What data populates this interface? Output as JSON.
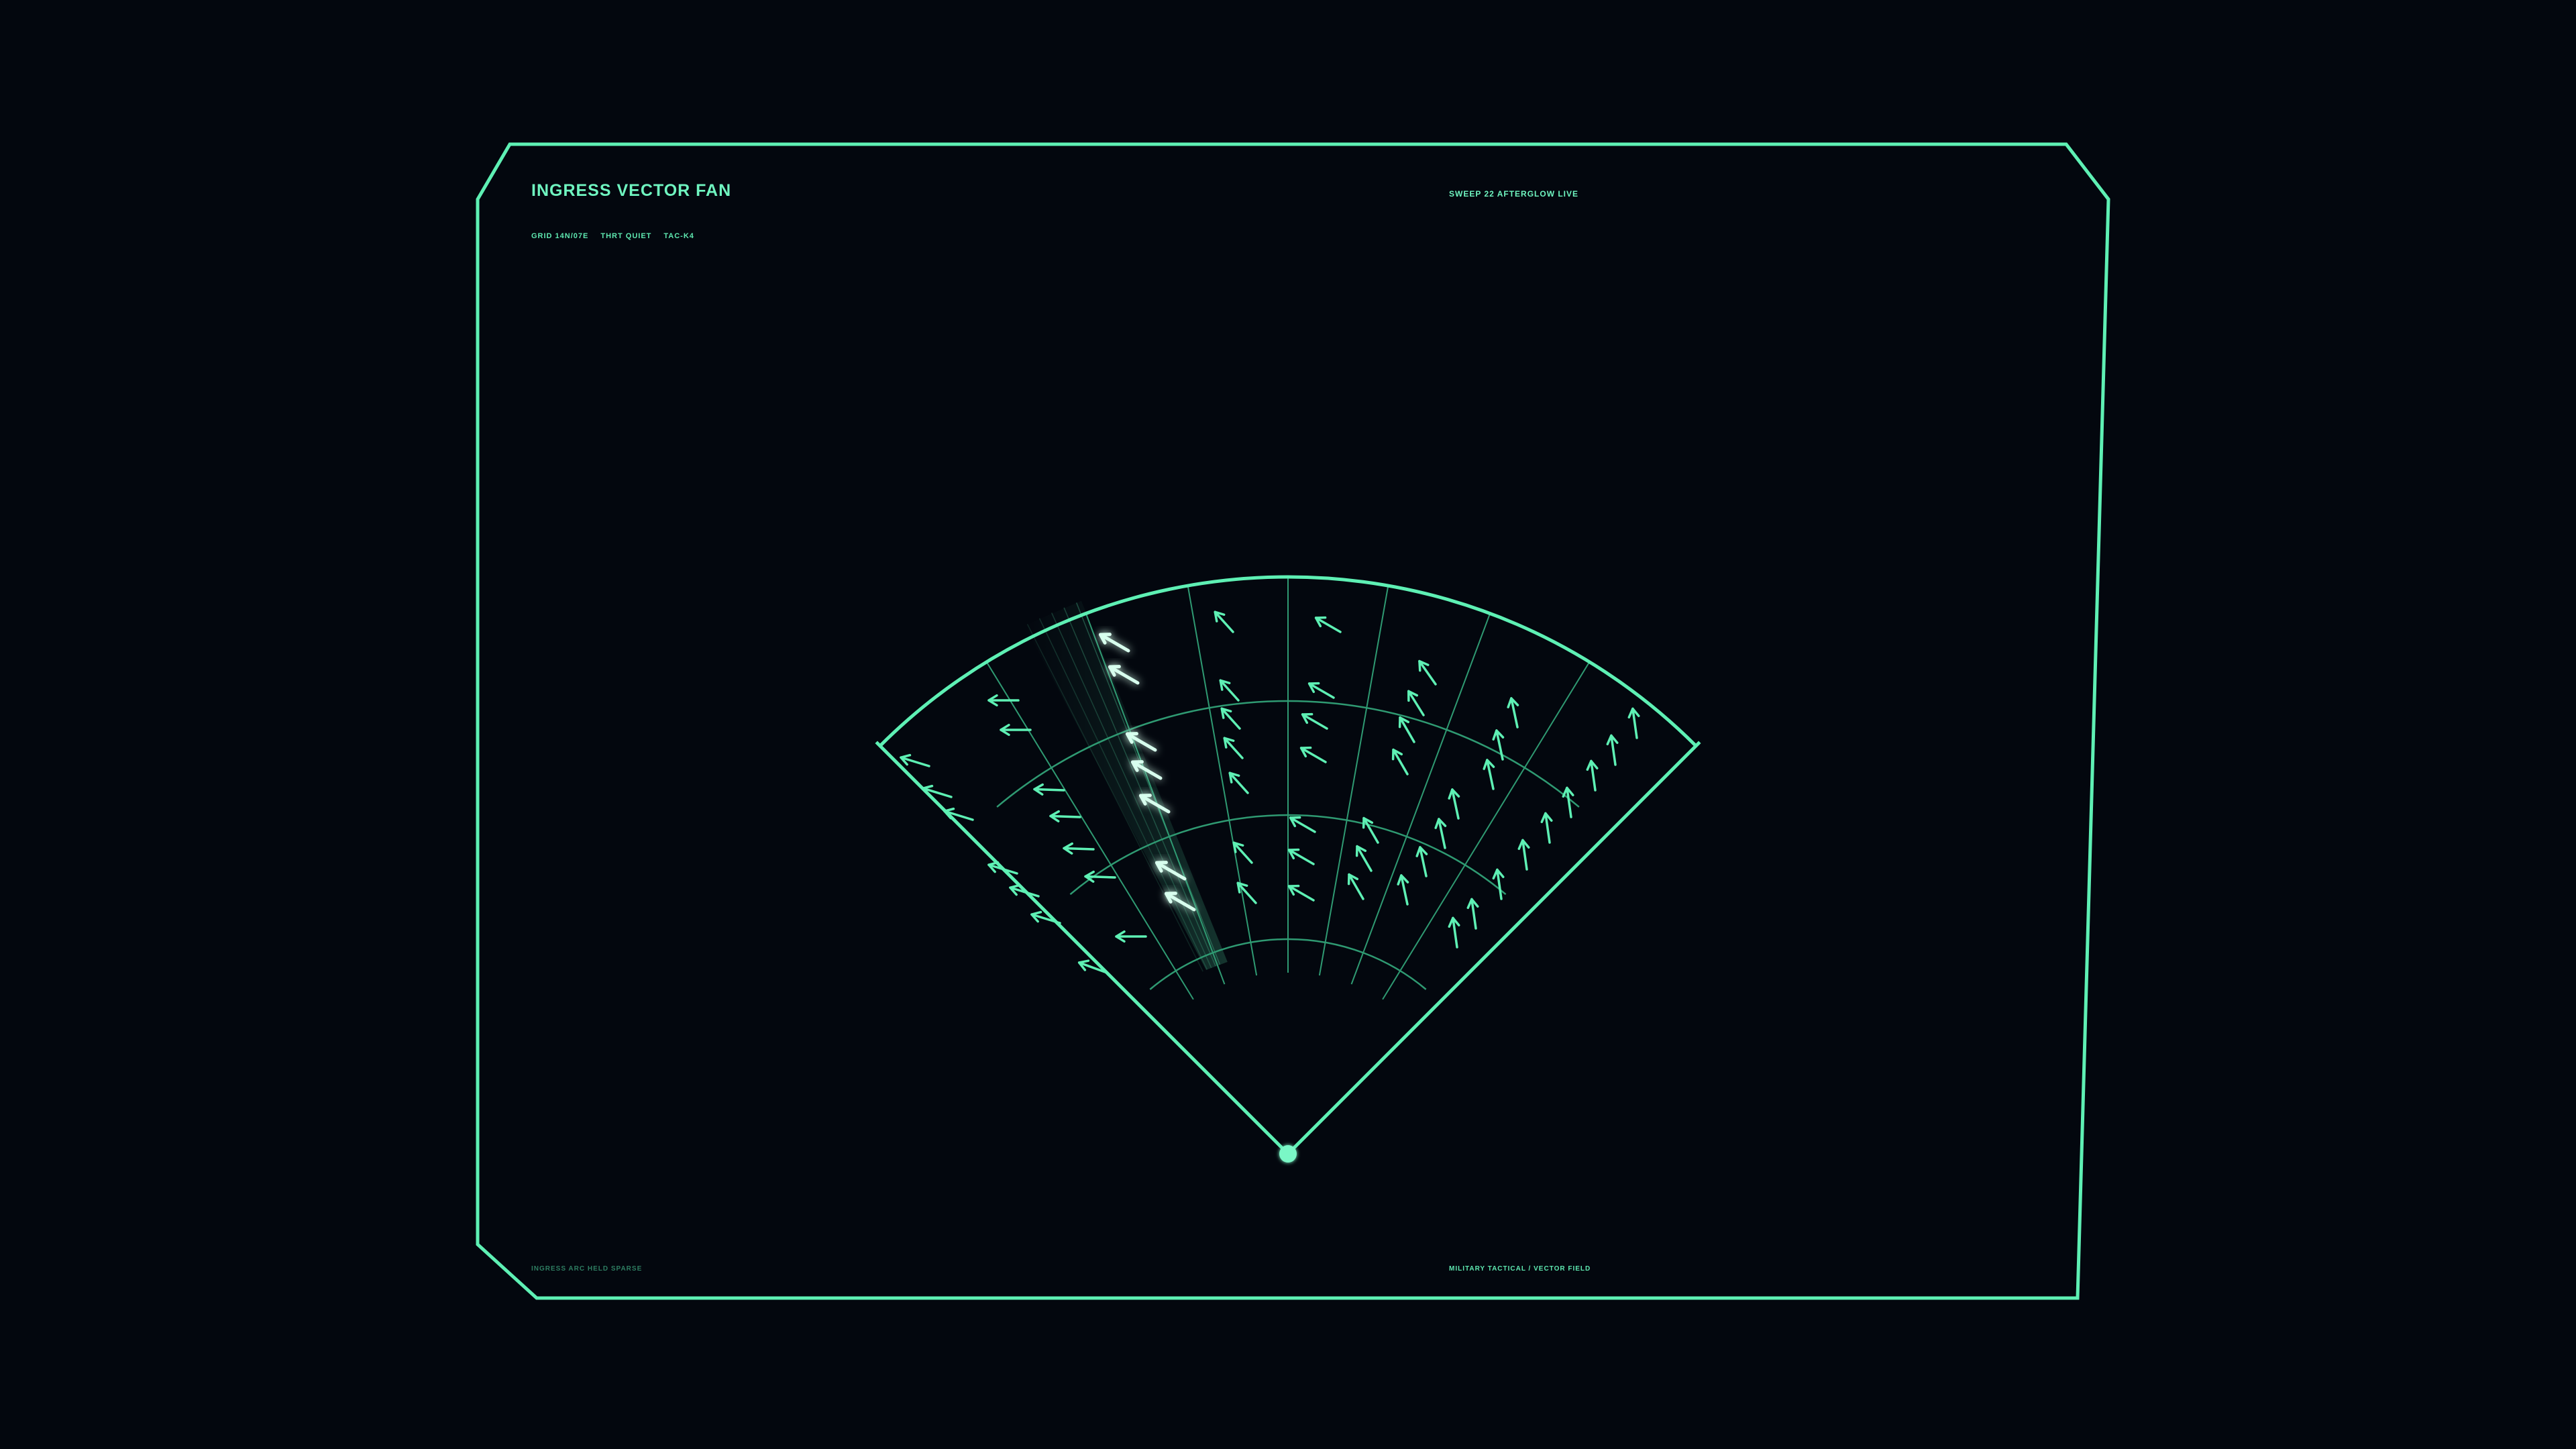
{
  "header": {
    "title": "INGRESS VECTOR FAN",
    "grid_ref": "GRID 14N/07E",
    "threat_state": "THRT QUIET",
    "tac_code": "TAC-K4",
    "sweep_status": "SWEEP 22  AFTERGLOW LIVE"
  },
  "footer": {
    "left_caption": "INGRESS ARC HELD SPARSE",
    "right_caption": "MILITARY TACTICAL  /  VECTOR FIELD"
  },
  "colors": {
    "background": "#03070e",
    "accent": "#5ef0b4",
    "grid": "#2f9a72",
    "dim": "#2e7d61",
    "highlight": "#d8ffee"
  },
  "icons": {
    "origin": "origin-dot-icon",
    "vector": "arrow-icon"
  }
}
